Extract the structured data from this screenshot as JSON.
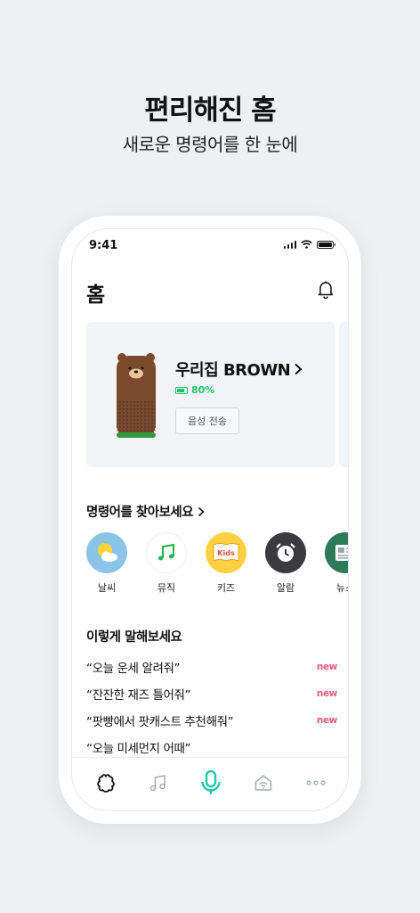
{
  "hero": {
    "title": "편리해진 홈",
    "subtitle": "새로운 명령어를 한 눈에"
  },
  "status": {
    "time": "9:41"
  },
  "page": {
    "title": "홈"
  },
  "device": {
    "name": "우리집 BROWN",
    "battery": "80%",
    "battery_level": 0.8,
    "voice_button": "음성 전송"
  },
  "commands": {
    "title": "명령어를 찾아보세요",
    "categories": [
      {
        "label": "날씨",
        "icon": "weather-icon"
      },
      {
        "label": "뮤직",
        "icon": "music-icon"
      },
      {
        "label": "키즈",
        "icon": "kids-icon",
        "badge": "Kids"
      },
      {
        "label": "알람",
        "icon": "alarm-icon"
      },
      {
        "label": "뉴스",
        "icon": "news-icon"
      }
    ]
  },
  "suggestions": {
    "title": "이렇게 말해보세요",
    "new_label": "new",
    "items": [
      {
        "text": "“오늘 운세 알려줘”",
        "new": true
      },
      {
        "text": "“잔잔한 재즈 틀어줘”",
        "new": true
      },
      {
        "text": "“팟빵에서 팟캐스트 추천해줘”",
        "new": true
      },
      {
        "text": "“오늘 미세먼지 어때”",
        "new": false
      }
    ]
  },
  "tabbar": [
    "home-tab-icon",
    "music-tab-icon",
    "mic-icon",
    "smart-home-icon",
    "more-icon"
  ],
  "colors": {
    "accent": "#1fc26a",
    "mic": "#1ec8a5",
    "new": "#ff5a78",
    "background": "#eef0f3"
  }
}
